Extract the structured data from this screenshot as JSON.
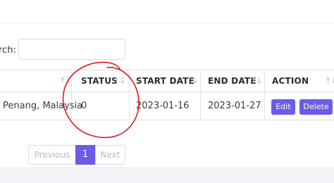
{
  "search": {
    "label": "rch:",
    "value": "",
    "placeholder": ""
  },
  "table": {
    "headers": {
      "status": "STATUS",
      "start_date": "START DATE",
      "end_date": "END DATE",
      "action": "ACTION"
    },
    "sort_glyph": "↑↓",
    "rows": [
      {
        "location": "Penang, Malaysia",
        "status": "0",
        "start_date": "2023-01-16",
        "end_date": "2023-01-27",
        "edit_label": "Edit",
        "delete_label": "Delete"
      }
    ]
  },
  "pagination": {
    "previous": "Previous",
    "current_page": "1",
    "next": "Next"
  },
  "colors": {
    "accent": "#6c5ce7",
    "annotation": "#e0191f"
  }
}
